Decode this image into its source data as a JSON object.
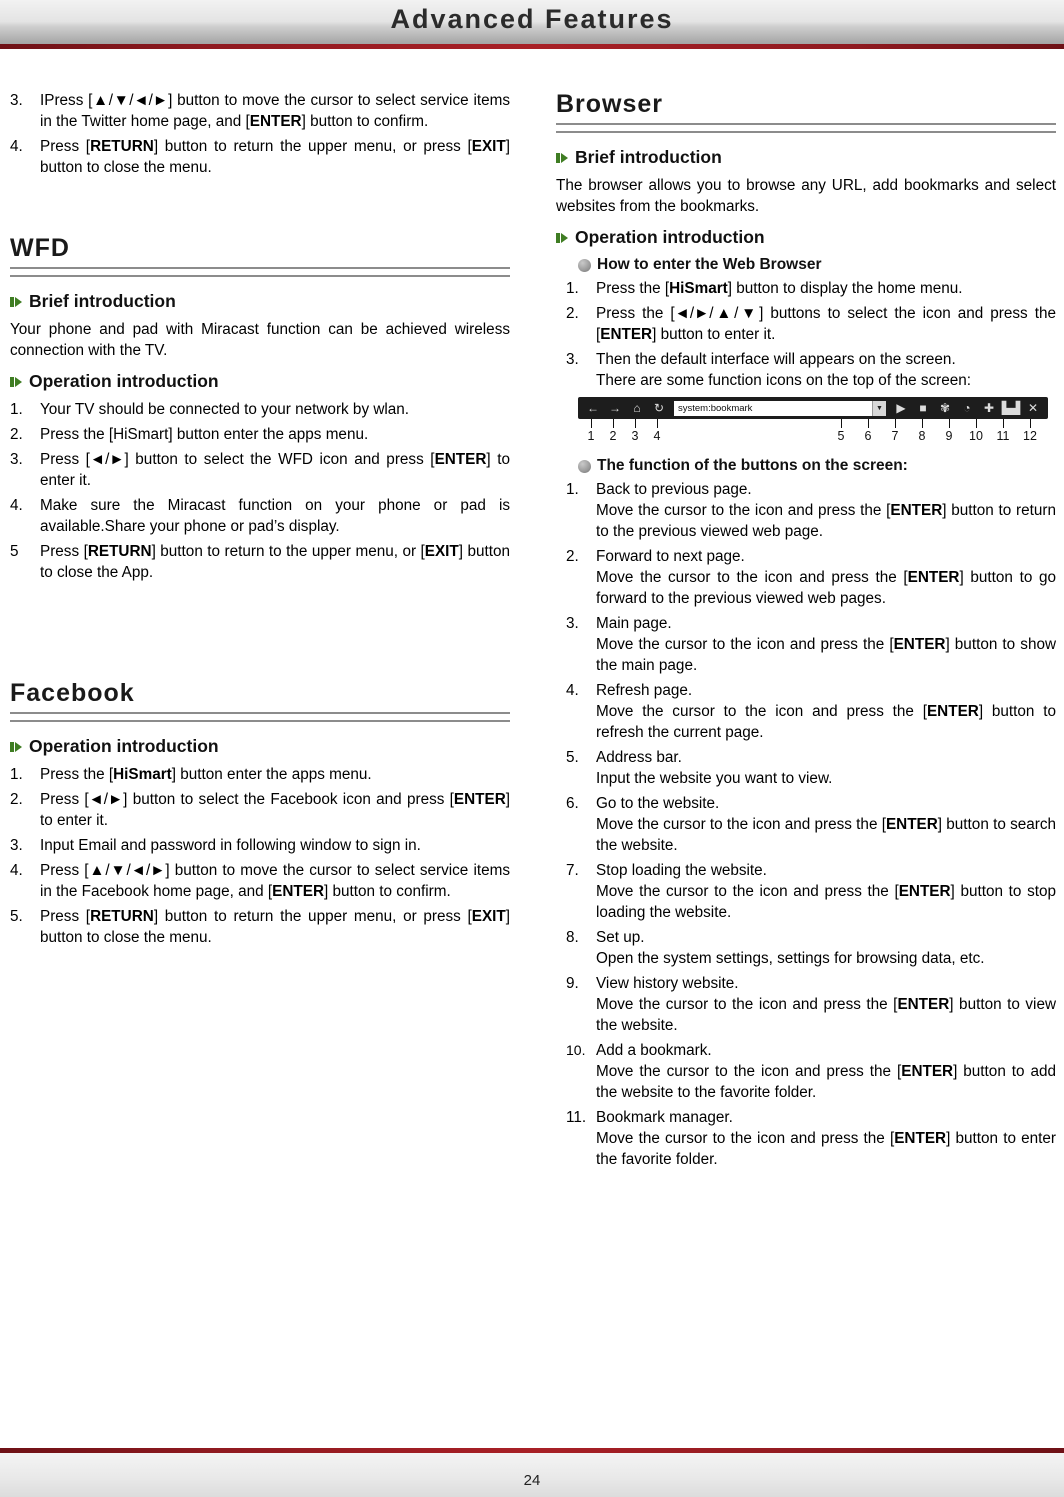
{
  "header": {
    "title": "Advanced Features"
  },
  "footer": {
    "page_number": "24"
  },
  "left": {
    "twitter_steps": [
      {
        "num": "3.",
        "parts": [
          "IPress [▲/▼/◄/►] button to move the cursor to select service items in the Twitter home page, and [",
          "ENTER",
          "] button to confirm."
        ]
      },
      {
        "num": "4.",
        "parts": [
          "Press [",
          "RETURN",
          "] button to return the upper menu, or press [",
          "EXIT",
          "] button to close the menu."
        ]
      }
    ],
    "wfd": {
      "title": "WFD",
      "brief_head": "Brief introduction",
      "brief_text": "Your phone and pad with Miracast function can be achieved wireless connection with the TV.",
      "op_head": "Operation introduction",
      "steps": [
        {
          "num": "1.",
          "text": "Your TV should be connected to your network by wlan."
        },
        {
          "num": "2.",
          "text": "Press the [HiSmart] button enter the apps menu."
        },
        {
          "num": "3.",
          "text_a": "Press [◄/►] button to select the WFD icon and press [",
          "bold": "ENTER",
          "text_b": "] to enter it."
        },
        {
          "num": "4.",
          "text": "Make sure the Miracast function on your phone or pad is available.Share your phone or pad’s display."
        },
        {
          "num": "5",
          "text_a": "Press [",
          "bold": "RETURN",
          "text_b": "] button to return to the upper menu, or [",
          "bold2": "EXIT",
          "text_c": "] button to close the App."
        }
      ]
    },
    "facebook": {
      "title": "Facebook",
      "op_head": "Operation introduction",
      "steps": [
        {
          "num": "1.",
          "text_a": "Press the [",
          "bold": "HiSmart",
          "text_b": "] button enter the apps menu."
        },
        {
          "num": "2.",
          "text_a": "Press [◄/►] button to select the Facebook icon and press [",
          "bold": "ENTER",
          "text_b": "] to enter it."
        },
        {
          "num": "3.",
          "text": "Input Email and password in following window to sign in."
        },
        {
          "num": "4.",
          "text_a": "Press [▲/▼/◄/►] button to move the cursor to select service items in the Facebook home page, and [",
          "bold": "ENTER",
          "text_b": "] button to confirm."
        },
        {
          "num": "5.",
          "text_a": "Press [",
          "bold": "RETURN",
          "text_b": "] button to return the upper menu, or press [",
          "bold2": "EXIT",
          "text_c": "] button to close the menu."
        }
      ]
    }
  },
  "right": {
    "title": "Browser",
    "brief_head": "Brief introduction",
    "brief_text": "The browser allows you to browse any URL, add bookmarks and select websites from the bookmarks.",
    "op_head": "Operation introduction",
    "enter_head": "How to enter the Web Browser",
    "enter_steps": [
      {
        "num": "1.",
        "text_a": "Press the [",
        "bold": "HiSmart",
        "text_b": "] button to display the home menu."
      },
      {
        "num": "2.",
        "text_a": "Press the [◄/►/▲/▼] buttons to select the icon and press the [",
        "bold": "ENTER",
        "text_b": "] button to enter it."
      },
      {
        "num": "3.",
        "text": "Then the default interface will appears on the screen.",
        "text2": "There are some function icons on the top of the screen:"
      }
    ],
    "toolbar": {
      "address_value": "system:bookmark",
      "icons": [
        {
          "name": "back-icon",
          "glyph": "←"
        },
        {
          "name": "forward-icon",
          "glyph": "→"
        },
        {
          "name": "home-icon",
          "glyph": "⌂"
        },
        {
          "name": "refresh-icon",
          "glyph": "↻"
        },
        {
          "name": "go-icon",
          "glyph": "▶"
        },
        {
          "name": "stop-icon",
          "glyph": "■"
        },
        {
          "name": "settings-icon",
          "glyph": "✾"
        },
        {
          "name": "history-icon",
          "glyph": "◔"
        },
        {
          "name": "add-bookmark-icon",
          "glyph": "✚"
        },
        {
          "name": "bookmark-manager-icon",
          "glyph": "▙▟"
        },
        {
          "name": "close-icon",
          "glyph": "✕"
        }
      ],
      "callouts": [
        "1",
        "2",
        "3",
        "4",
        "5",
        "6",
        "7",
        "8",
        "9",
        "10",
        "11",
        "12"
      ]
    },
    "function_head": "The function of the buttons on the screen:",
    "functions": [
      {
        "num": "1.",
        "title": "Back to previous page.",
        "line_a": "Move the cursor to the icon and press the [",
        "bold": "ENTER",
        "line_b": "] button to return to the previous viewed web page."
      },
      {
        "num": "2.",
        "title": "Forward to next page.",
        "line_a": "Move the cursor to the icon and press the [",
        "bold": "ENTER",
        "line_b": "] button to go forward to the previous viewed web pages."
      },
      {
        "num": "3.",
        "title": "Main page.",
        "line_a": "Move the cursor to the icon and press the [",
        "bold": "ENTER",
        "line_b": "] button to show the main page."
      },
      {
        "num": "4.",
        "title": "Refresh page.",
        "line_a": "Move the cursor to the icon and press the [",
        "bold": "ENTER",
        "line_b": "] button to refresh the current page."
      },
      {
        "num": "5.",
        "title": "Address bar.",
        "line_plain": "Input the website you want to view."
      },
      {
        "num": "6.",
        "title": "Go to the website.",
        "line_a": "Move the cursor to the icon and press the [",
        "bold": "ENTER",
        "line_b": "] button to search the website."
      },
      {
        "num": "7.",
        "title": "Stop loading the website.",
        "line_a": "Move the cursor to the icon and press the [",
        "bold": "ENTER",
        "line_b": "] button to stop loading the website."
      },
      {
        "num": "8.",
        "title": "Set up.",
        "line_plain": "Open the system settings, settings for browsing data, etc."
      },
      {
        "num": "9.",
        "title": "View history website.",
        "line_a": "Move the cursor to the icon and press the [",
        "bold": "ENTER",
        "line_b": "] button to view the website."
      },
      {
        "num": "10.",
        "title": "Add a bookmark.",
        "line_a": "Move the cursor to the icon and press the [",
        "bold": "ENTER",
        "line_b": "] button to add the website to the favorite folder."
      },
      {
        "num": "11.",
        "title": "Bookmark manager.",
        "line_a": "Move the cursor to the icon and press the [",
        "bold": "ENTER",
        "line_b": "] button to enter the favorite folder."
      }
    ]
  }
}
